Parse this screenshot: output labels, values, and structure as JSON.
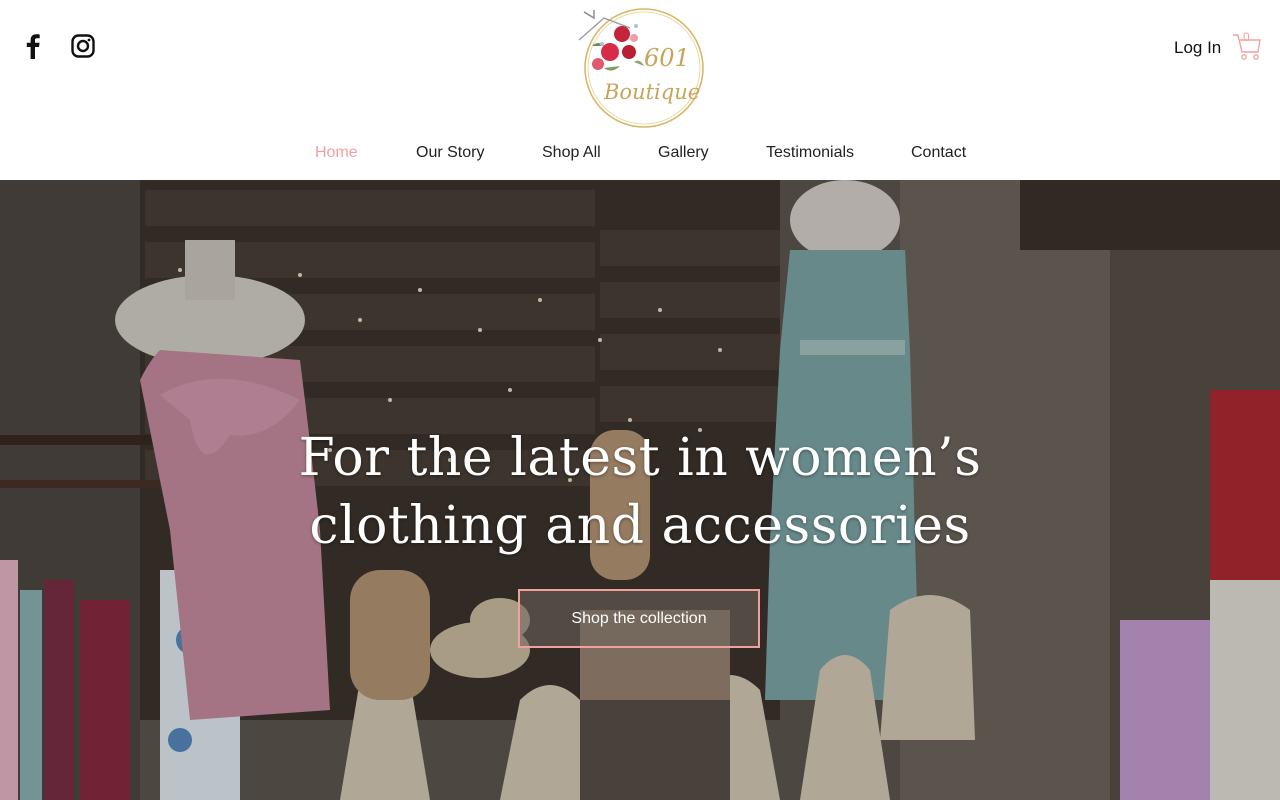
{
  "header": {
    "logo": {
      "line1": "601",
      "line2": "Boutique"
    },
    "social": [
      "facebook-icon",
      "instagram-icon"
    ],
    "login_label": "Log In",
    "cart_count": "0"
  },
  "nav": {
    "items": [
      {
        "label": "Home",
        "active": true
      },
      {
        "label": "Our Story"
      },
      {
        "label": "Shop All"
      },
      {
        "label": "Gallery"
      },
      {
        "label": "Testimonials"
      },
      {
        "label": "Contact"
      }
    ]
  },
  "hero": {
    "title_line1": "For the latest in women’s",
    "title_line2": "clothing and accessories",
    "cta_label": "Shop the collection"
  },
  "colors": {
    "accent": "#f2a09f",
    "gold": "#c7a45a"
  }
}
